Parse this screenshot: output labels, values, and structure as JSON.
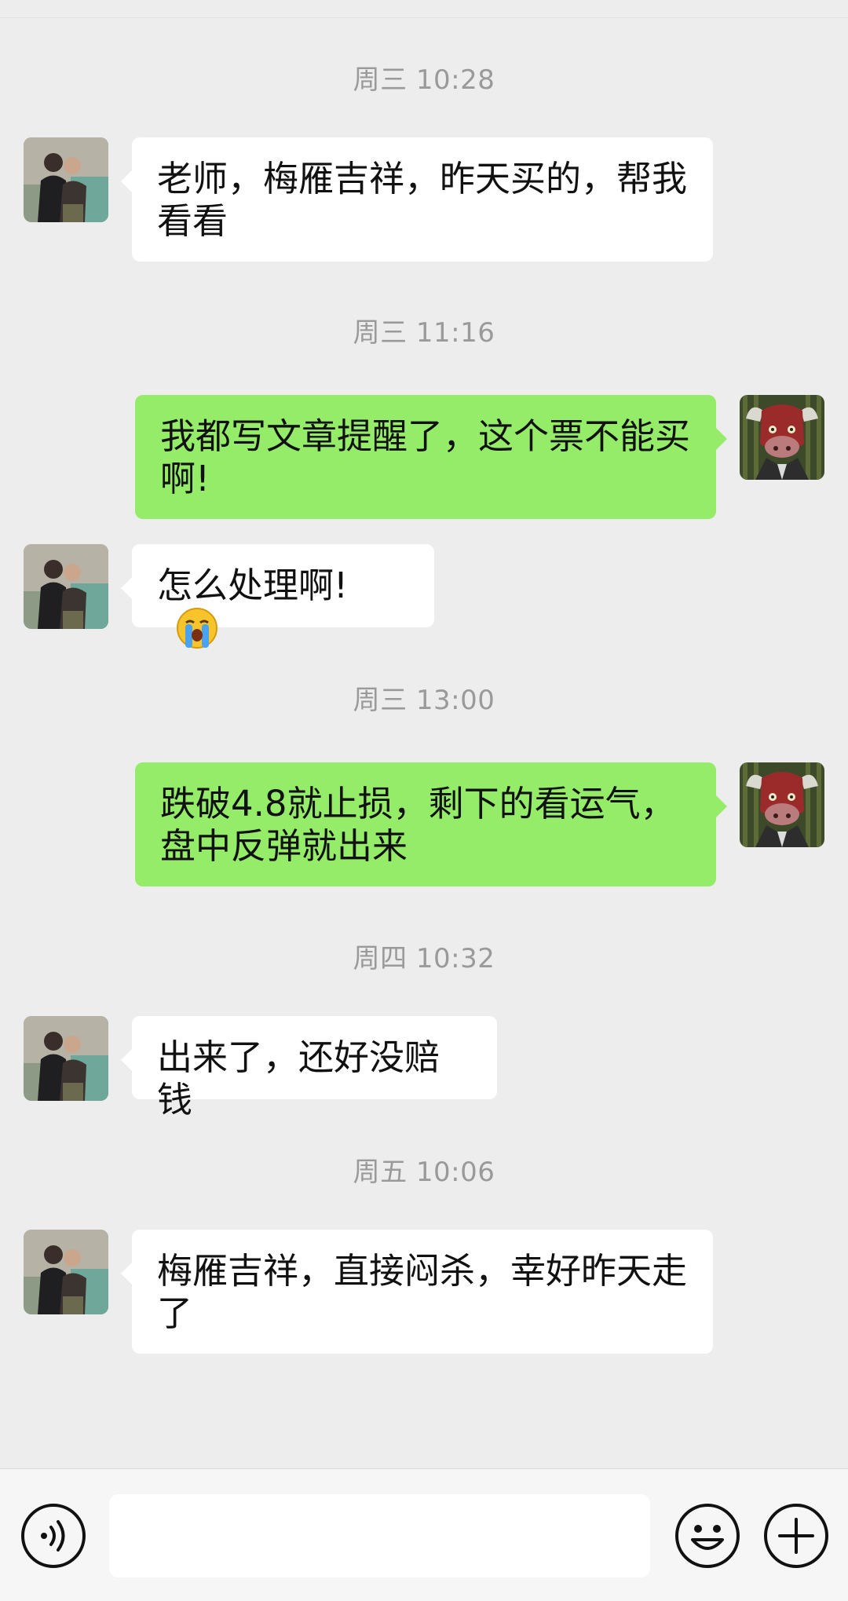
{
  "chat": {
    "timestamps": [
      "周三 10:28",
      "周三 11:16",
      "周三 13:00",
      "周四 10:32",
      "周五 10:06"
    ],
    "messages": [
      {
        "sender": "other",
        "text": "老师，梅雁吉祥，昨天买的，帮我\n看看"
      },
      {
        "sender": "me",
        "text": "我都写文章提醒了，这个票不能买\n啊!"
      },
      {
        "sender": "other",
        "text": "怎么处理啊!",
        "emoji": "crying-face"
      },
      {
        "sender": "me",
        "text": "跌破4.8就止损，剩下的看运气，\n盘中反弹就出来"
      },
      {
        "sender": "other",
        "text": "出来了，还好没赔钱"
      },
      {
        "sender": "other",
        "text": "梅雁吉祥，直接闷杀，幸好昨天走\n了"
      }
    ]
  },
  "input_bar": {
    "value": "",
    "icons": [
      "voice-icon",
      "emoji-icon",
      "plus-icon"
    ]
  },
  "colors": {
    "background": "#ededed",
    "incoming_bubble": "#ffffff",
    "outgoing_bubble": "#95ec69",
    "timestamp_text": "#9a9a9a"
  }
}
